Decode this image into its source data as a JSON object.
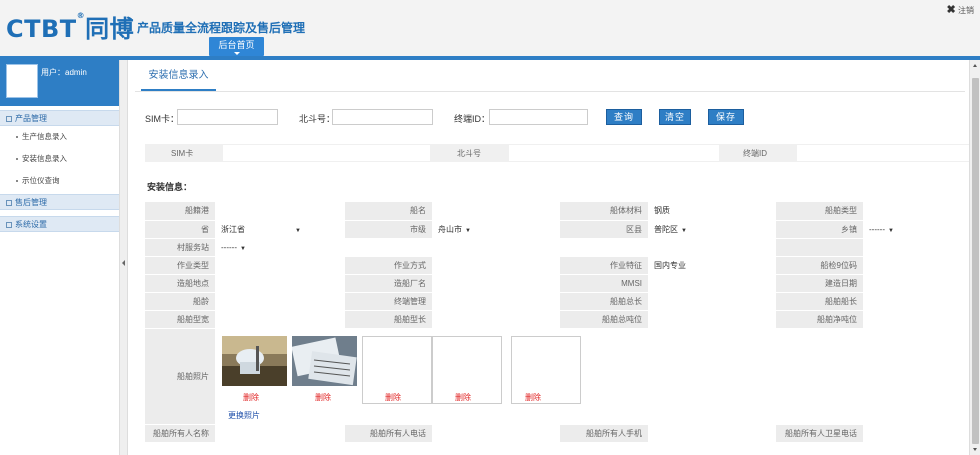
{
  "header": {
    "logo_latin": "CTBT",
    "logo_reg": "®",
    "logo_cn": "同博",
    "subtitle": "产品质量全流程跟踪及售后管理",
    "logout_icon": "✖",
    "logout_label": "注销",
    "home_tab": "后台首页"
  },
  "sidebar": {
    "user_label": "用户：admin",
    "groups": [
      {
        "label": "产品管理",
        "items": [
          "生产信息录入",
          "安装信息录入",
          "示位仪查询"
        ]
      },
      {
        "label": "售后管理"
      },
      {
        "label": "系统设置"
      }
    ]
  },
  "main": {
    "page_tab": "安装信息录入",
    "search": {
      "sim_label": "SIM卡：",
      "beidou_label": "北斗号：",
      "terminal_label": "终端ID：",
      "query_btn": "查询",
      "clear_btn": "清空",
      "save_btn": "保存"
    },
    "filter": {
      "sim": "SIM卡",
      "beidou": "北斗号",
      "terminal": "终端ID"
    },
    "section_title": "安装信息：",
    "rows": [
      [
        [
          "船籍港",
          ""
        ],
        [
          "船名",
          ""
        ],
        [
          "船体材料",
          "钢质"
        ],
        [
          "船舶类型",
          ""
        ]
      ],
      [
        [
          "省",
          "浙江省"
        ],
        [
          "市级",
          "舟山市"
        ],
        [
          "区县",
          "普陀区"
        ],
        [
          "乡镇",
          "------"
        ]
      ],
      [
        [
          "村服务站",
          "------"
        ]
      ],
      [
        [
          "作业类型",
          ""
        ],
        [
          "作业方式",
          ""
        ],
        [
          "作业特征",
          "国内专业"
        ],
        [
          "船检9位码",
          ""
        ]
      ],
      [
        [
          "造船地点",
          ""
        ],
        [
          "造船厂名",
          ""
        ],
        [
          "MMSI",
          ""
        ],
        [
          "建造日期",
          ""
        ]
      ],
      [
        [
          "船龄",
          ""
        ],
        [
          "终端管理",
          ""
        ],
        [
          "船舶总长",
          ""
        ],
        [
          "船舶船长",
          ""
        ]
      ],
      [
        [
          "船舶型宽",
          ""
        ],
        [
          "船舶型长",
          ""
        ],
        [
          "船舶总吨位",
          ""
        ],
        [
          "船舶净吨位",
          ""
        ]
      ]
    ],
    "photo_label": "船舶照片",
    "delete_label": "删除",
    "change_photo": "更换照片",
    "owner_row": [
      "船舶所有人名称",
      "船舶所有人电话",
      "船舶所有人手机",
      "船舶所有人卫星电话"
    ]
  }
}
